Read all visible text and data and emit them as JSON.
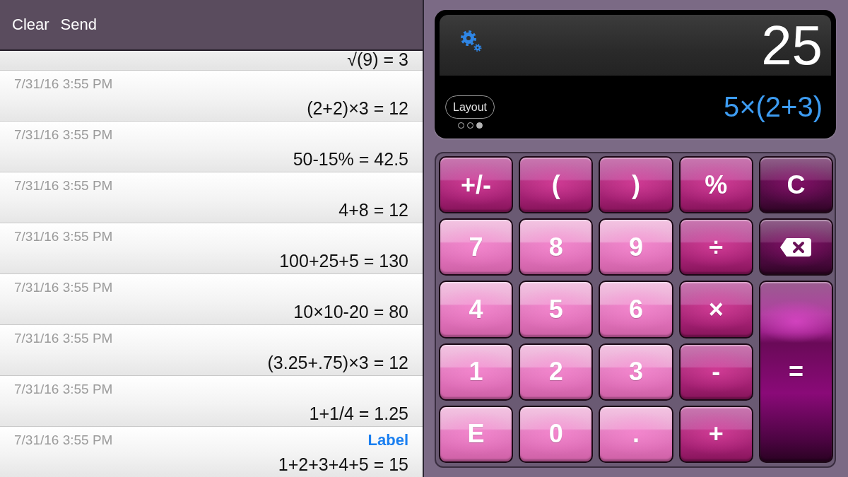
{
  "toolbar": {
    "buttons": [
      {
        "label": "Clear"
      },
      {
        "label": "Send"
      }
    ]
  },
  "history": [
    {
      "expression": "√(9) = 3"
    },
    {
      "timestamp": "7/31/16 3:55 PM",
      "expression": "(2+2)×3 = 12"
    },
    {
      "timestamp": "7/31/16 3:55 PM",
      "expression": "50-15% = 42.5"
    },
    {
      "timestamp": "7/31/16 3:55 PM",
      "expression": "4+8 = 12"
    },
    {
      "timestamp": "7/31/16 3:55 PM",
      "expression": "100+25+5 = 130"
    },
    {
      "timestamp": "7/31/16 3:55 PM",
      "expression": "10×10-20 = 80"
    },
    {
      "timestamp": "7/31/16 3:55 PM",
      "expression": "(3.25+.75)×3 = 12"
    },
    {
      "timestamp": "7/31/16 3:55 PM",
      "expression": "1+1/4 = 1.25"
    },
    {
      "timestamp": "7/31/16 3:55 PM",
      "label": "Label",
      "expression": "1+2+3+4+5 = 15"
    }
  ],
  "display": {
    "result": "25",
    "expression": "5×(2+3)",
    "layout_button": "Layout",
    "page_dots": [
      {
        "selected": false
      },
      {
        "selected": false
      },
      {
        "selected": true
      }
    ]
  },
  "keypad": [
    {
      "label": "+/-",
      "kind": "function"
    },
    {
      "label": "(",
      "kind": "function"
    },
    {
      "label": ")",
      "kind": "function"
    },
    {
      "label": "%",
      "kind": "function"
    },
    {
      "label": "C",
      "kind": "clear"
    },
    {
      "label": "7",
      "kind": "digit"
    },
    {
      "label": "8",
      "kind": "digit"
    },
    {
      "label": "9",
      "kind": "digit"
    },
    {
      "label": "÷",
      "kind": "operator"
    },
    {
      "kind": "backspace"
    },
    {
      "label": "4",
      "kind": "digit"
    },
    {
      "label": "5",
      "kind": "digit"
    },
    {
      "label": "6",
      "kind": "digit"
    },
    {
      "label": "×",
      "kind": "operator"
    },
    {
      "label": "1",
      "kind": "digit"
    },
    {
      "label": "2",
      "kind": "digit"
    },
    {
      "label": "3",
      "kind": "digit"
    },
    {
      "label": "-",
      "kind": "operator"
    },
    {
      "label": "=",
      "kind": "equals"
    },
    {
      "label": "E",
      "kind": "digit"
    },
    {
      "label": "0",
      "kind": "digit"
    },
    {
      "label": ".",
      "kind": "digit"
    },
    {
      "label": "+",
      "kind": "operator"
    }
  ]
}
